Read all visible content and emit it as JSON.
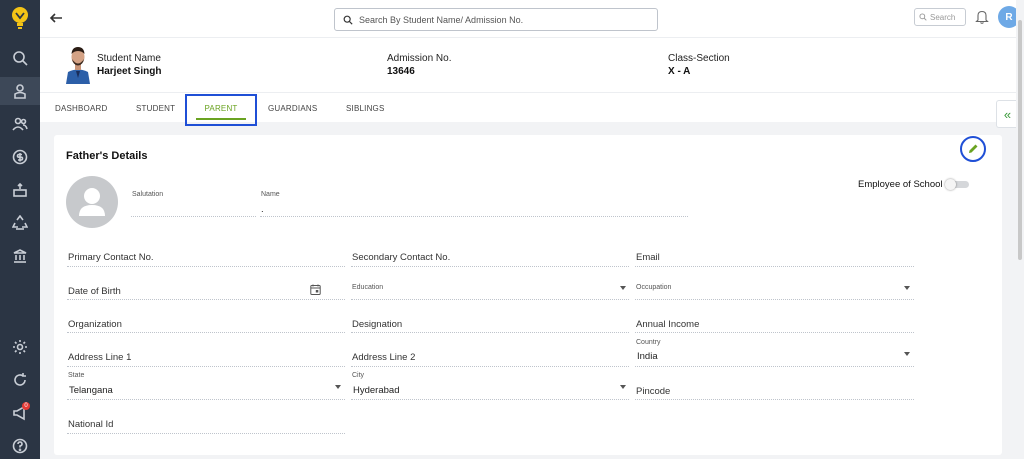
{
  "sidebar": {
    "items": [
      {
        "name": "search-icon"
      },
      {
        "name": "student-icon"
      },
      {
        "name": "people-icon"
      },
      {
        "name": "fees-icon"
      },
      {
        "name": "hand-money-icon"
      },
      {
        "name": "recycle-icon"
      },
      {
        "name": "library-icon"
      },
      {
        "name": "settings-icon"
      },
      {
        "name": "refresh-icon"
      },
      {
        "name": "megaphone-icon"
      },
      {
        "name": "help-icon"
      }
    ],
    "notification_badge": "0"
  },
  "topbar": {
    "search_placeholder": "Search By Student Name/ Admission No.",
    "small_search_placeholder": "Search",
    "avatar_initial": "R"
  },
  "student": {
    "name_label": "Student Name",
    "name": "Harjeet Singh",
    "admission_label": "Admission No.",
    "admission_no": "13646",
    "class_label": "Class-Section",
    "class_section": "X - A"
  },
  "tabs": [
    {
      "label": "DASHBOARD"
    },
    {
      "label": "STUDENT"
    },
    {
      "label": "PARENT",
      "active": true
    },
    {
      "label": "GUARDIANS"
    },
    {
      "label": "SIBLINGS"
    }
  ],
  "card": {
    "title": "Father's Details",
    "salutation_label": "Salutation",
    "name_label": "Name",
    "name_value": ".",
    "employee_of_school_label": "Employee of School",
    "employee_of_school": false,
    "fields": {
      "primary_contact": "Primary Contact No.",
      "secondary_contact": "Secondary Contact No.",
      "email": "Email",
      "dob": "Date of Birth",
      "education": "Education",
      "occupation": "Occupation",
      "organization": "Organization",
      "designation": "Designation",
      "annual_income": "Annual Income",
      "address1": "Address Line 1",
      "address2": "Address Line 2",
      "country_label": "Country",
      "country_value": "India",
      "state_label": "State",
      "state_value": "Telangana",
      "city_label": "City",
      "city_value": "Hyderabad",
      "pincode": "Pincode",
      "national_id": "National Id"
    }
  },
  "colors": {
    "sidebar_bg": "#2b3544",
    "accent_green": "#6aa321",
    "highlight_blue": "#1f4fd6"
  }
}
